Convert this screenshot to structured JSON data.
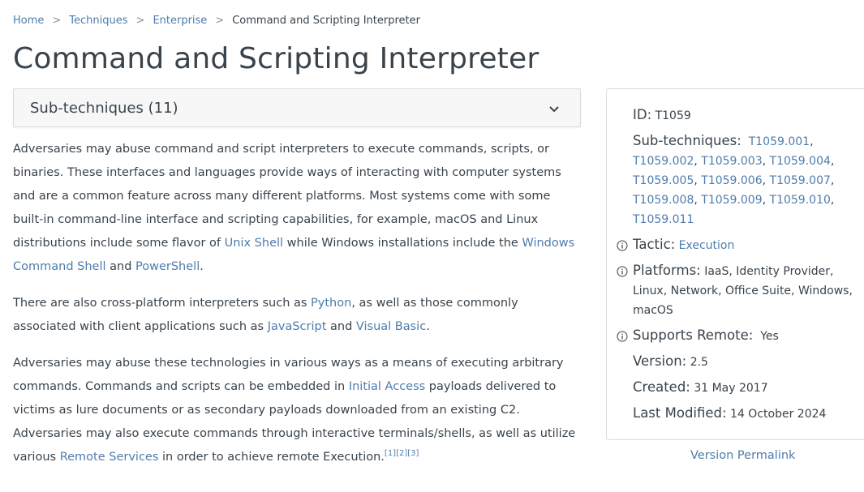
{
  "breadcrumb": [
    "Home",
    "Techniques",
    "Enterprise",
    "Command and Scripting Interpreter"
  ],
  "breadcrumb_sep": ">",
  "title": "Command and Scripting Interpreter",
  "subtechniques_toggle": "Sub-techniques (11)",
  "description": {
    "p1": {
      "t1": "Adversaries may abuse command and script interpreters to execute commands, scripts, or binaries. These interfaces and languages provide ways of interacting with computer systems and are a common feature across many different platforms. Most systems come with some built-in command-line interface and scripting capabilities, for example, macOS and Linux distributions include some flavor of ",
      "l1": "Unix Shell",
      "t2": " while Windows installations include the ",
      "l2": "Windows Command Shell",
      "t3": " and ",
      "l3": "PowerShell",
      "t4": "."
    },
    "p2": {
      "t1": "There are also cross-platform interpreters such as ",
      "l1": "Python",
      "t2": ", as well as those commonly associated with client applications such as ",
      "l2": "JavaScript",
      "t3": " and ",
      "l3": "Visual Basic",
      "t4": "."
    },
    "p3": {
      "t1": "Adversaries may abuse these technologies in various ways as a means of executing arbitrary commands. Commands and scripts can be embedded in ",
      "l1": "Initial Access",
      "t2": " payloads delivered to victims as lure documents or as secondary payloads downloaded from an existing C2. Adversaries may also execute commands through interactive terminals/shells, as well as utilize various ",
      "l2": "Remote Services",
      "t3": " in order to achieve remote Execution.",
      "refs": [
        "[1]",
        "[2]",
        "[3]"
      ]
    }
  },
  "card": {
    "id_label": "ID:",
    "id_value": "T1059",
    "subtech_label": "Sub-techniques:",
    "subtechs": [
      "T1059.001",
      "T1059.002",
      "T1059.003",
      "T1059.004",
      "T1059.005",
      "T1059.006",
      "T1059.007",
      "T1059.008",
      "T1059.009",
      "T1059.010",
      "T1059.011"
    ],
    "tactic_label": "Tactic:",
    "tactic_value": "Execution",
    "platforms_label": "Platforms:",
    "platforms_value": "IaaS, Identity Provider, Linux, Network, Office Suite, Windows, macOS",
    "remote_label": "Supports Remote:",
    "remote_value": "Yes",
    "version_label": "Version:",
    "version_value": "2.5",
    "created_label": "Created:",
    "created_value": "31 May 2017",
    "modified_label": "Last Modified:",
    "modified_value": "14 October 2024"
  },
  "permalink": "Version Permalink"
}
